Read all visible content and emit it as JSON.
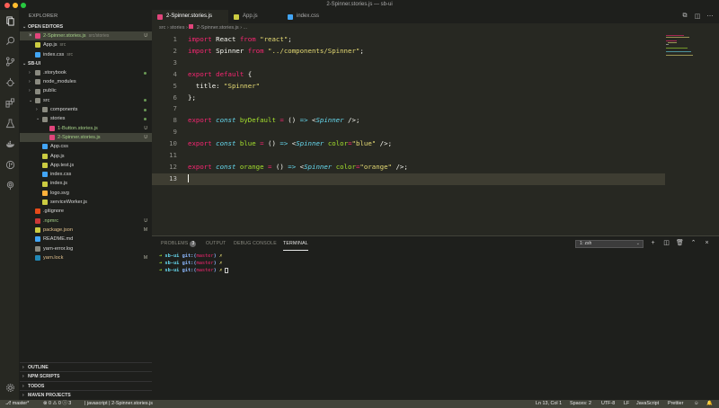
{
  "window": {
    "title": "2-Spinner.stories.js — sb-ui"
  },
  "sidebar": {
    "header": "EXPLORER",
    "open_editors_title": "OPEN EDITORS",
    "open_editors": [
      {
        "name": "2-Spinner.stories.js",
        "path": "src/stories",
        "badge": "U",
        "icon_color": "#e0457b",
        "close": "×"
      },
      {
        "name": "App.js",
        "path": "src",
        "badge": "",
        "icon_color": "#cbcb41"
      },
      {
        "name": "index.css",
        "path": "src",
        "badge": "",
        "icon_color": "#42a5f5"
      }
    ],
    "project_title": "SB-UI",
    "tree": [
      {
        "name": ".storybook",
        "type": "folder",
        "depth": 0,
        "status": "dot"
      },
      {
        "name": "node_modules",
        "type": "folder",
        "depth": 0,
        "status": ""
      },
      {
        "name": "public",
        "type": "folder",
        "depth": 0,
        "status": ""
      },
      {
        "name": "src",
        "type": "folder-open",
        "depth": 0,
        "status": "dot"
      },
      {
        "name": "components",
        "type": "folder",
        "depth": 1,
        "status": "dot"
      },
      {
        "name": "stories",
        "type": "folder-open",
        "depth": 1,
        "status": "dot"
      },
      {
        "name": "1-Button.stories.js",
        "type": "file",
        "depth": 2,
        "status": "U",
        "icon_color": "#e0457b"
      },
      {
        "name": "2-Spinner.stories.js",
        "type": "file",
        "depth": 2,
        "status": "U",
        "icon_color": "#e0457b",
        "selected": true
      },
      {
        "name": "App.css",
        "type": "file",
        "depth": 1,
        "status": "",
        "icon_color": "#42a5f5"
      },
      {
        "name": "App.js",
        "type": "file",
        "depth": 1,
        "status": "",
        "icon_color": "#cbcb41"
      },
      {
        "name": "App.test.js",
        "type": "file",
        "depth": 1,
        "status": "",
        "icon_color": "#cbcb41"
      },
      {
        "name": "index.css",
        "type": "file",
        "depth": 1,
        "status": "",
        "icon_color": "#42a5f5"
      },
      {
        "name": "index.js",
        "type": "file",
        "depth": 1,
        "status": "",
        "icon_color": "#cbcb41"
      },
      {
        "name": "logo.svg",
        "type": "file",
        "depth": 1,
        "status": "",
        "icon_color": "#ffb13b"
      },
      {
        "name": "serviceWorker.js",
        "type": "file",
        "depth": 1,
        "status": "",
        "icon_color": "#cbcb41"
      },
      {
        "name": ".gitignore",
        "type": "file",
        "depth": 0,
        "status": "",
        "icon_color": "#e64a19"
      },
      {
        "name": ".npmrc",
        "type": "file",
        "depth": 0,
        "status": "U",
        "icon_color": "#cb3837"
      },
      {
        "name": "package.json",
        "type": "file",
        "depth": 0,
        "status": "M",
        "icon_color": "#cbcb41"
      },
      {
        "name": "README.md",
        "type": "file",
        "depth": 0,
        "status": "",
        "icon_color": "#42a5f5"
      },
      {
        "name": "yarn-error.log",
        "type": "file",
        "depth": 0,
        "status": "",
        "icon_color": "#8a8a80"
      },
      {
        "name": "yarn.lock",
        "type": "file",
        "depth": 0,
        "status": "M",
        "icon_color": "#2188b6"
      }
    ],
    "bottom_sections": [
      "OUTLINE",
      "NPM SCRIPTS",
      "TODOS",
      "MAVEN PROJECTS"
    ]
  },
  "tabs": [
    {
      "label": "2-Spinner.stories.js",
      "active": true,
      "icon_color": "#e0457b"
    },
    {
      "label": "App.js",
      "active": false,
      "icon_color": "#cbcb41"
    },
    {
      "label": "index.css",
      "active": false,
      "icon_color": "#42a5f5"
    }
  ],
  "breadcrumb": [
    "src",
    "stories",
    "2-Spinner.stories.js",
    "..."
  ],
  "editor": {
    "current_line": 13,
    "lines": [
      {
        "n": "1",
        "tokens": [
          [
            "kw",
            "import"
          ],
          [
            "pun",
            " React "
          ],
          [
            "kw",
            "from"
          ],
          [
            "pun",
            " "
          ],
          [
            "str",
            "\"react\""
          ],
          [
            "pun",
            ";"
          ]
        ]
      },
      {
        "n": "2",
        "tokens": [
          [
            "kw",
            "import"
          ],
          [
            "pun",
            " Spinner "
          ],
          [
            "kw",
            "from"
          ],
          [
            "pun",
            " "
          ],
          [
            "str",
            "\"../components/Spinner\""
          ],
          [
            "pun",
            ";"
          ]
        ]
      },
      {
        "n": "3",
        "tokens": []
      },
      {
        "n": "4",
        "tokens": [
          [
            "kw",
            "export"
          ],
          [
            "pun",
            " "
          ],
          [
            "kw",
            "default"
          ],
          [
            "pun",
            " {"
          ]
        ]
      },
      {
        "n": "5",
        "tokens": [
          [
            "pun",
            "  title: "
          ],
          [
            "str",
            "\"Spinner\""
          ]
        ]
      },
      {
        "n": "6",
        "tokens": [
          [
            "pun",
            "};"
          ]
        ]
      },
      {
        "n": "7",
        "tokens": []
      },
      {
        "n": "8",
        "tokens": [
          [
            "kw",
            "export"
          ],
          [
            "pun",
            " "
          ],
          [
            "type",
            "const"
          ],
          [
            "pun",
            " "
          ],
          [
            "fn",
            "byDefault"
          ],
          [
            "pun",
            " "
          ],
          [
            "kw",
            "="
          ],
          [
            "pun",
            " () "
          ],
          [
            "type",
            "=>"
          ],
          [
            "pun",
            " <"
          ],
          [
            "type",
            "Spinner"
          ],
          [
            "pun",
            " />;"
          ]
        ]
      },
      {
        "n": "9",
        "tokens": []
      },
      {
        "n": "10",
        "tokens": [
          [
            "kw",
            "export"
          ],
          [
            "pun",
            " "
          ],
          [
            "type",
            "const"
          ],
          [
            "pun",
            " "
          ],
          [
            "fn",
            "blue"
          ],
          [
            "pun",
            " "
          ],
          [
            "kw",
            "="
          ],
          [
            "pun",
            " () "
          ],
          [
            "type",
            "=>"
          ],
          [
            "pun",
            " <"
          ],
          [
            "type",
            "Spinner"
          ],
          [
            "pun",
            " "
          ],
          [
            "attr",
            "color"
          ],
          [
            "kw",
            "="
          ],
          [
            "str",
            "\"blue\""
          ],
          [
            "pun",
            " />;"
          ]
        ]
      },
      {
        "n": "11",
        "tokens": []
      },
      {
        "n": "12",
        "tokens": [
          [
            "kw",
            "export"
          ],
          [
            "pun",
            " "
          ],
          [
            "type",
            "const"
          ],
          [
            "pun",
            " "
          ],
          [
            "fn",
            "orange"
          ],
          [
            "pun",
            " "
          ],
          [
            "kw",
            "="
          ],
          [
            "pun",
            " () "
          ],
          [
            "type",
            "=>"
          ],
          [
            "pun",
            " <"
          ],
          [
            "type",
            "Spinner"
          ],
          [
            "pun",
            " "
          ],
          [
            "attr",
            "color"
          ],
          [
            "kw",
            "="
          ],
          [
            "str",
            "\"orange\""
          ],
          [
            "pun",
            " />;"
          ]
        ]
      },
      {
        "n": "13",
        "tokens": []
      }
    ]
  },
  "panel": {
    "tabs": [
      {
        "label": "PROBLEMS",
        "badge": "3",
        "active": false
      },
      {
        "label": "OUTPUT",
        "active": false
      },
      {
        "label": "DEBUG CONSOLE",
        "active": false
      },
      {
        "label": "TERMINAL",
        "active": true
      }
    ],
    "terminal_select": "1: zsh",
    "terminal_lines": [
      {
        "arrow": "➜",
        "dir": "sb-ui",
        "git": "git:(",
        "branch": "master",
        "git_close": ")",
        "mark": "✗",
        "cursor": false
      },
      {
        "arrow": "➜",
        "dir": "sb-ui",
        "git": "git:(",
        "branch": "master",
        "git_close": ")",
        "mark": "✗",
        "cursor": false
      },
      {
        "arrow": "➜",
        "dir": "sb-ui",
        "git": "git:(",
        "branch": "master",
        "git_close": ")",
        "mark": "✗",
        "cursor": true
      }
    ]
  },
  "statusbar": {
    "branch": "master*",
    "problems": "⊗ 0 ⚠ 0 ⓘ 3",
    "language_mode": "javascript",
    "file": "2-Spinner.stories.js",
    "position": "Ln 13, Col 1",
    "spaces": "Spaces: 2",
    "encoding": "UTF-8",
    "eol": "LF",
    "language": "JavaScript",
    "formatter": "Prettier"
  },
  "colors": {
    "editor_bg": "#272822",
    "sidebar_bg": "#1e1f1c",
    "statusbar_bg": "#414339",
    "keyword": "#f92672",
    "string": "#e6db74",
    "function": "#a6e22e",
    "type": "#66d9ef"
  }
}
